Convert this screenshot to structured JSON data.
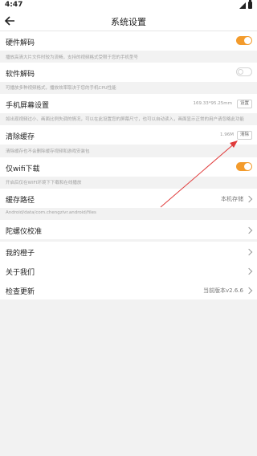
{
  "status": {
    "time": "4:47"
  },
  "header": {
    "title": "系统设置"
  },
  "hardware": {
    "label": "硬件解码",
    "desc": "播放高清大片文件时较为流畅，支持的视频格式受限于您的手机型号",
    "enabled": true
  },
  "software": {
    "label": "软件解码",
    "desc": "可播放多种视频格式，播放效率取决于您的手机CPU性能",
    "enabled": false
  },
  "screen": {
    "label": "手机屏幕设置",
    "value": "169.33*95.25mm",
    "button": "设置",
    "desc": "如出现视频过小、画面比例失调的情况，可以在此设置您的屏幕尺寸，也可以自动读入，画面显示正常的用户请忽略此功能"
  },
  "cache": {
    "label": "清除缓存",
    "value": "1.96M",
    "button": "清除",
    "desc": "清除缓存也不会删除缓存视频和游戏安装包"
  },
  "wifi": {
    "label": "仅wifi下载",
    "desc": "开启后仅在WIFI环境下下载和在线播放",
    "enabled": true
  },
  "cachepath": {
    "label": "缓存路径",
    "value": "本机存储",
    "path": "Android/data/com.chengzivr.android/files"
  },
  "gyro": {
    "label": "陀螺仪校准"
  },
  "orange": {
    "label": "我的橙子"
  },
  "about": {
    "label": "关于我们"
  },
  "update": {
    "label": "检查更新",
    "value": "当前版本v2.6.6"
  },
  "colors": {
    "accent": "#f39b2c",
    "arrow": "#e03a3a"
  }
}
